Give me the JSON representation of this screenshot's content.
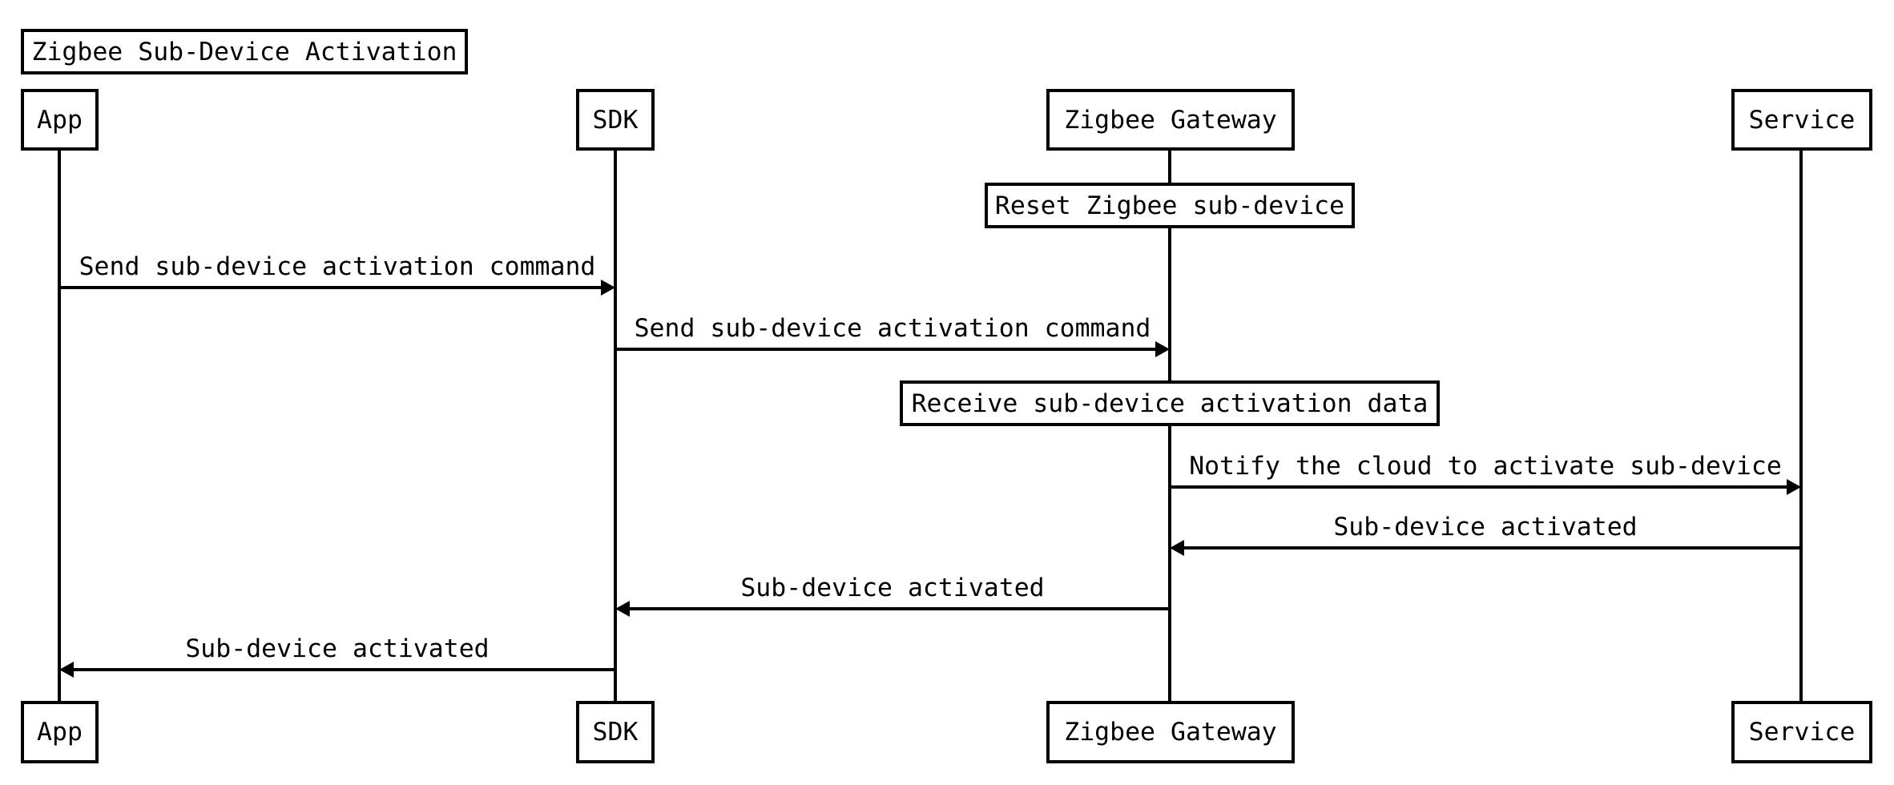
{
  "diagram": {
    "title": "Zigbee Sub-Device Activation",
    "participants": [
      {
        "id": "app",
        "label": "App"
      },
      {
        "id": "sdk",
        "label": "SDK"
      },
      {
        "id": "gateway",
        "label": "Zigbee Gateway"
      },
      {
        "id": "service",
        "label": "Service"
      }
    ],
    "notes": [
      {
        "over": "gateway",
        "text": "Reset Zigbee sub-device"
      },
      {
        "over": "gateway",
        "text": "Receive sub-device activation data"
      }
    ],
    "messages": [
      {
        "from": "app",
        "to": "sdk",
        "text": "Send sub-device activation command"
      },
      {
        "from": "sdk",
        "to": "gateway",
        "text": "Send sub-device activation command"
      },
      {
        "from": "gateway",
        "to": "service",
        "text": "Notify the cloud to activate sub-device"
      },
      {
        "from": "service",
        "to": "gateway",
        "text": "Sub-device activated"
      },
      {
        "from": "gateway",
        "to": "sdk",
        "text": "Sub-device activated"
      },
      {
        "from": "sdk",
        "to": "app",
        "text": "Sub-device activated"
      }
    ]
  }
}
